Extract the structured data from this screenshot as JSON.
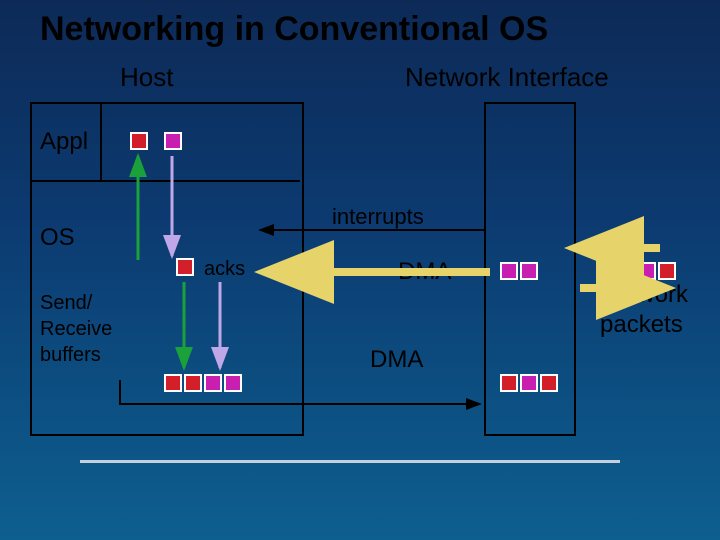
{
  "title": "Networking in Conventional OS",
  "labels": {
    "host": "Host",
    "network_interface": "Network Interface",
    "appl": "Appl",
    "os": "OS",
    "send_receive_buffers": "Send/\nReceive\nbuffers",
    "acks": "acks",
    "interrupts": "interrupts",
    "dma_in": "DMA",
    "dma_out": "DMA",
    "network_packets": "Network\npackets"
  },
  "colors": {
    "packet_red": "#d21f2a",
    "packet_magenta": "#c81fb0",
    "arrow_green": "#1aa13a",
    "arrow_lav": "#c0a8e8",
    "arrow_yellow": "#e6d36a"
  }
}
